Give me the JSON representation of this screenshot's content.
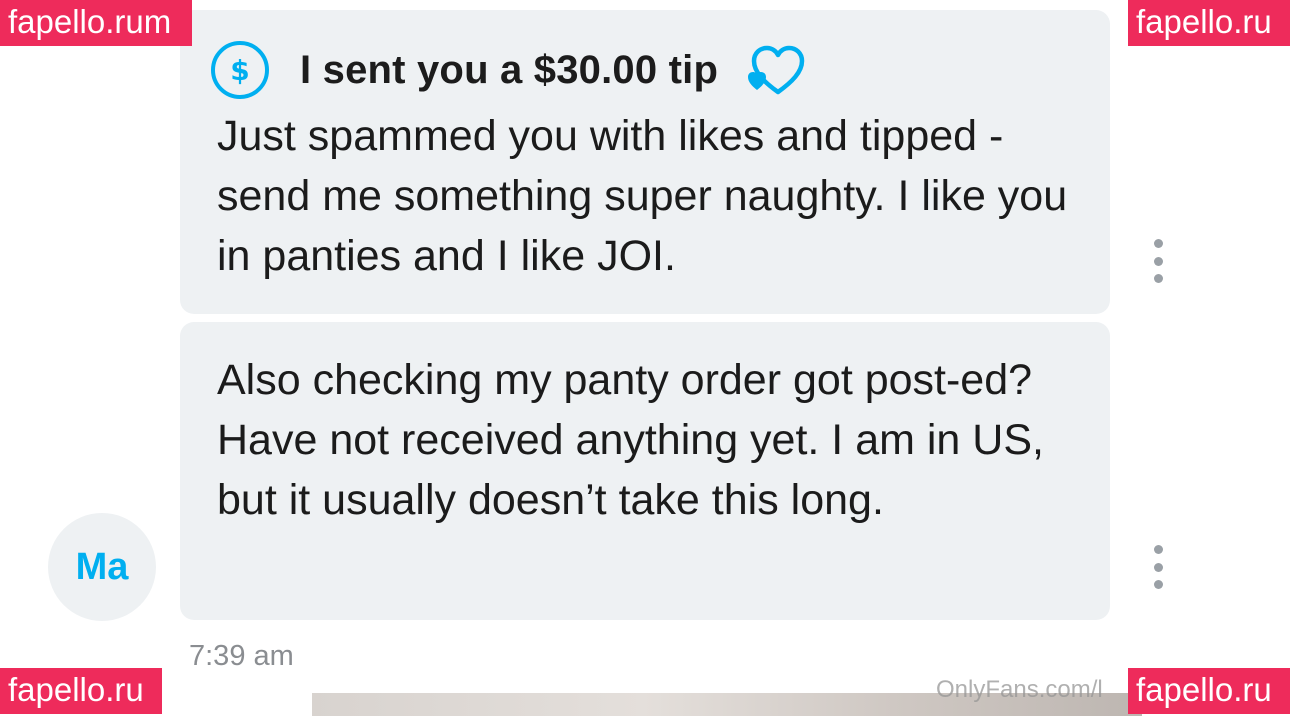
{
  "messages": [
    {
      "tip_text": "I sent you a $30.00 tip",
      "icon": "dollar-circle-icon",
      "tip_icon": "heart-icon",
      "text": "Just spammed you with likes and tipped - send me something super naughty. I like you in panties and I like JOI."
    },
    {
      "text": "Also checking my panty order got post-ed? Have not received anything yet. I am in US, but it usually doesn’t take this long."
    }
  ],
  "sender": {
    "avatar_initials": "Ma"
  },
  "timestamp": "7:39 am",
  "watermarks": {
    "top_left": "fapello.rum",
    "top_right": "fapello.ru",
    "bottom_left": "fapello.ru",
    "bottom_right": "fapello.ru",
    "onlyfans": "OnlyFans.com/l"
  },
  "colors": {
    "accent": "#00aff0",
    "bubble": "#eef1f3",
    "watermark_bg": "#ee2b5b"
  }
}
